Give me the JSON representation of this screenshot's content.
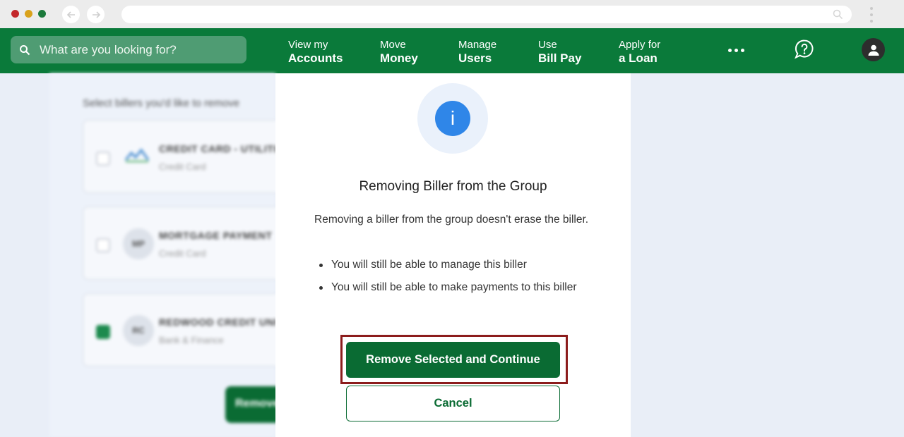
{
  "browser": {
    "back_icon": "arrow-left-icon",
    "forward_icon": "arrow-right-icon",
    "url_search_icon": "search-icon",
    "menu_icon": "kebab-menu-icon"
  },
  "topnav": {
    "search_placeholder": "What are you looking for?",
    "items": [
      {
        "line1": "View my",
        "line2": "Accounts"
      },
      {
        "line1": "Move",
        "line2": "Money"
      },
      {
        "line1": "Manage",
        "line2": "Users"
      },
      {
        "line1": "Use",
        "line2": "Bill Pay"
      },
      {
        "line1": "Apply for",
        "line2": "a Loan"
      }
    ],
    "more_icon": "more-dots-icon",
    "help_icon": "help-chat-icon",
    "profile_icon": "user-icon"
  },
  "background": {
    "heading": "Select billers you'd like to remove",
    "billers": [
      {
        "name": "CREDIT CARD - UTILITIES",
        "type": "Credit Card",
        "avatar": "",
        "checked": false
      },
      {
        "name": "MORTGAGE PAYMENT",
        "type": "Credit Card",
        "avatar": "MP",
        "checked": false
      },
      {
        "name": "REDWOOD CREDIT UNION",
        "type": "Bank & Finance",
        "avatar": "RC",
        "checked": true
      }
    ],
    "button_label": "Remove"
  },
  "modal": {
    "icon": "info-icon",
    "icon_glyph": "i",
    "title": "Removing Biller from the Group",
    "description": "Removing a biller from the group doesn't erase the biller.",
    "bullets": [
      "You will still be able to manage this biller",
      "You will still be able to make payments to this biller"
    ],
    "primary_label": "Remove Selected and Continue",
    "secondary_label": "Cancel"
  },
  "colors": {
    "brand_green": "#0a7a3a",
    "button_green": "#0a6b33",
    "info_blue": "#2f86e8",
    "highlight_red": "#8c1c1c"
  }
}
